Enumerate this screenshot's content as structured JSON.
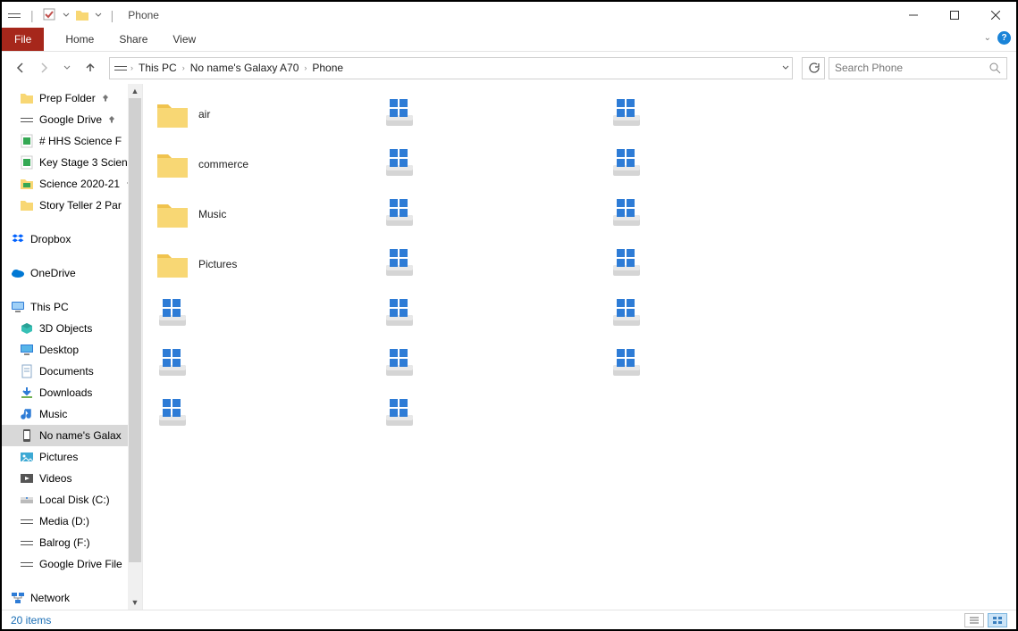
{
  "window": {
    "title": "Phone"
  },
  "ribbon": {
    "file": "File",
    "tabs": [
      "Home",
      "Share",
      "View"
    ]
  },
  "breadcrumbs": [
    "This PC",
    "No name's Galaxy A70",
    "Phone"
  ],
  "search": {
    "placeholder": "Search Phone"
  },
  "sidebar": {
    "quick": [
      {
        "label": "Prep Folder",
        "icon": "folder",
        "pinned": true
      },
      {
        "label": "Google Drive",
        "icon": "drive",
        "pinned": true
      },
      {
        "label": "# HHS Science F",
        "icon": "gsheet",
        "pinned": true
      },
      {
        "label": "Key Stage 3 Scien",
        "icon": "gsheet",
        "pinned": true
      },
      {
        "label": "Science 2020-21",
        "icon": "gfolder",
        "pinned": true
      },
      {
        "label": "Story Teller 2 Par",
        "icon": "folder"
      }
    ],
    "clouds": [
      {
        "label": "Dropbox",
        "icon": "dropbox"
      },
      {
        "label": "OneDrive",
        "icon": "onedrive"
      }
    ],
    "thispc": {
      "label": "This PC"
    },
    "pcitems": [
      {
        "label": "3D Objects",
        "icon": "3d"
      },
      {
        "label": "Desktop",
        "icon": "desktop"
      },
      {
        "label": "Documents",
        "icon": "docs"
      },
      {
        "label": "Downloads",
        "icon": "downloads"
      },
      {
        "label": "Music",
        "icon": "music"
      },
      {
        "label": "No name's Galax",
        "icon": "phone",
        "selected": true
      },
      {
        "label": "Pictures",
        "icon": "pictures"
      },
      {
        "label": "Videos",
        "icon": "videos"
      },
      {
        "label": "Local Disk (C:)",
        "icon": "disk"
      },
      {
        "label": "Media (D:)",
        "icon": "drive"
      },
      {
        "label": "Balrog (F:)",
        "icon": "drive"
      },
      {
        "label": "Google Drive File",
        "icon": "drive"
      }
    ],
    "network": {
      "label": "Network"
    }
  },
  "files": {
    "items": [
      {
        "name": "air",
        "type": "folder"
      },
      {
        "name": "commerce",
        "type": "folder"
      },
      {
        "name": "Music",
        "type": "folder"
      },
      {
        "name": "Pictures",
        "type": "folder"
      },
      {
        "name": "",
        "type": "system"
      },
      {
        "name": "",
        "type": "system"
      },
      {
        "name": "",
        "type": "system"
      },
      {
        "name": "",
        "type": "system"
      },
      {
        "name": "",
        "type": "system"
      },
      {
        "name": "",
        "type": "system"
      },
      {
        "name": "",
        "type": "system"
      },
      {
        "name": "",
        "type": "system"
      },
      {
        "name": "",
        "type": "system"
      },
      {
        "name": "",
        "type": "system"
      },
      {
        "name": "",
        "type": "system"
      },
      {
        "name": "",
        "type": "system"
      },
      {
        "name": "",
        "type": "system"
      },
      {
        "name": "",
        "type": "system"
      },
      {
        "name": "",
        "type": "system"
      },
      {
        "name": "",
        "type": "system"
      }
    ]
  },
  "status": {
    "count": "20 items"
  }
}
